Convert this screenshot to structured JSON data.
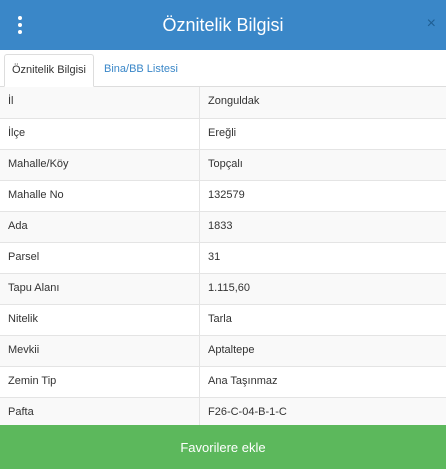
{
  "header": {
    "title": "Öznitelik Bilgisi",
    "close_label": "×",
    "color": "#3a87c8"
  },
  "tabs": [
    {
      "label": "Öznitelik Bilgisi",
      "active": true
    },
    {
      "label": "Bina/BB Listesi",
      "active": false
    }
  ],
  "attributes": [
    {
      "key": "İl",
      "value": "Zonguldak"
    },
    {
      "key": "İlçe",
      "value": "Ereğli"
    },
    {
      "key": "Mahalle/Köy",
      "value": "Topçalı"
    },
    {
      "key": "Mahalle No",
      "value": "132579"
    },
    {
      "key": "Ada",
      "value": "1833"
    },
    {
      "key": "Parsel",
      "value": "31"
    },
    {
      "key": "Tapu Alanı",
      "value": "1.115,60"
    },
    {
      "key": "Nitelik",
      "value": "Tarla"
    },
    {
      "key": "Mevkii",
      "value": "Aptaltepe"
    },
    {
      "key": "Zemin Tip",
      "value": "Ana Taşınmaz"
    },
    {
      "key": "Pafta",
      "value": "F26-C-04-B-1-C"
    }
  ],
  "footer": {
    "button_label": "Favorilere ekle",
    "color": "#5cb85c"
  }
}
